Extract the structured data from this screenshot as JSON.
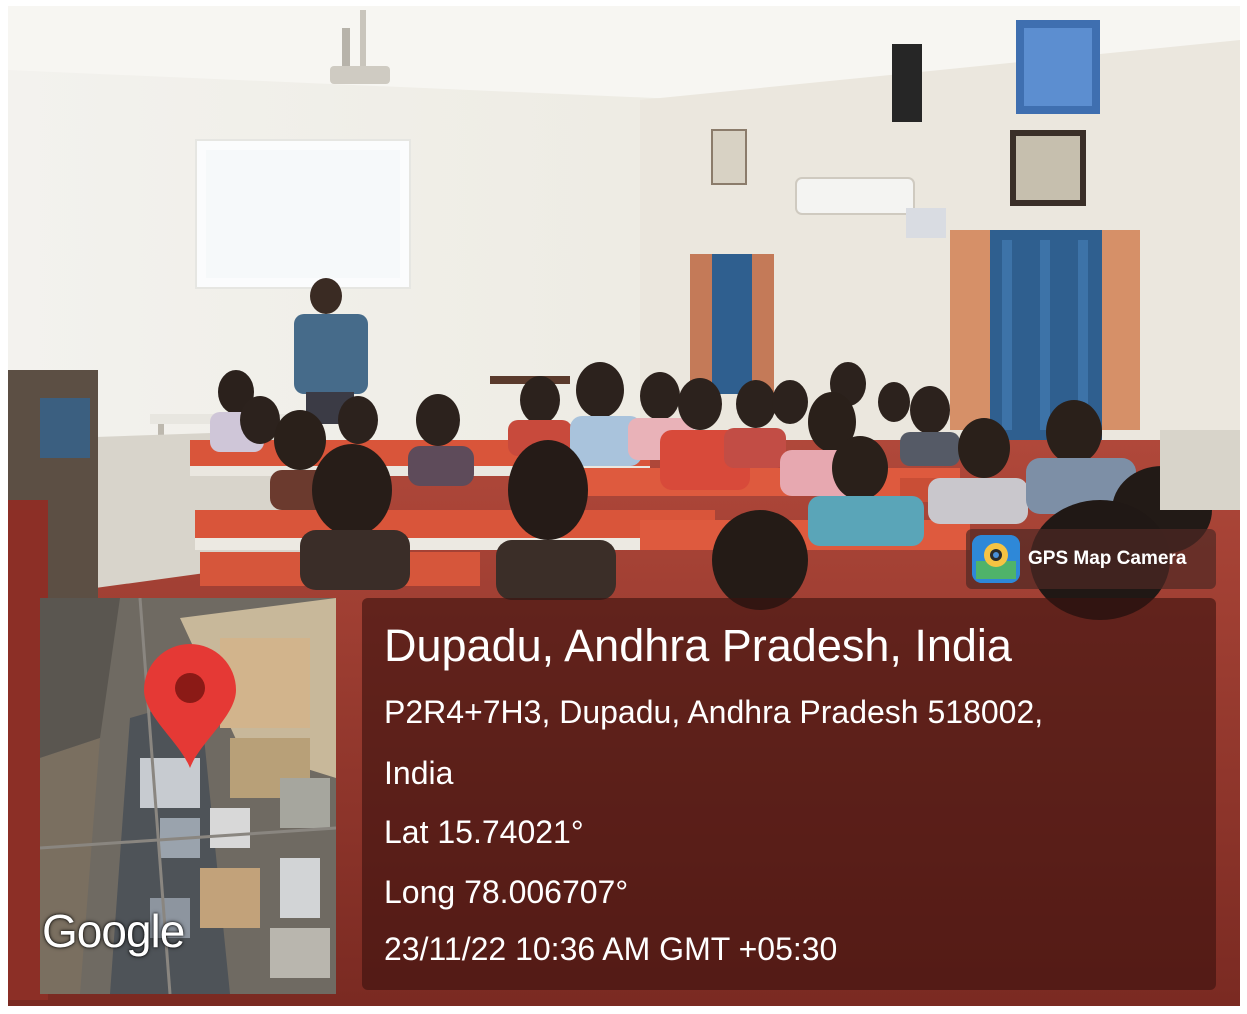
{
  "overlay": {
    "badge_label": "GPS Map Camera",
    "badge_icon": "gps-map-camera-app-icon",
    "title": "Dupadu, Andhra Pradesh, India",
    "address_line1": "P2R4+7H3, Dupadu, Andhra Pradesh 518002,",
    "address_line2": "India",
    "latitude": "Lat 15.74021°",
    "longitude": "Long 78.006707°",
    "timestamp": "23/11/22 10:36 AM GMT +05:30"
  },
  "map": {
    "attribution": "Google",
    "marker_icon": "map-pin-icon",
    "marker_color": "#e53935"
  },
  "colors": {
    "panel": "#3c120e",
    "desk": "#d9553a",
    "wall": "#f1efe8",
    "curtain": "#2f5f8f"
  }
}
